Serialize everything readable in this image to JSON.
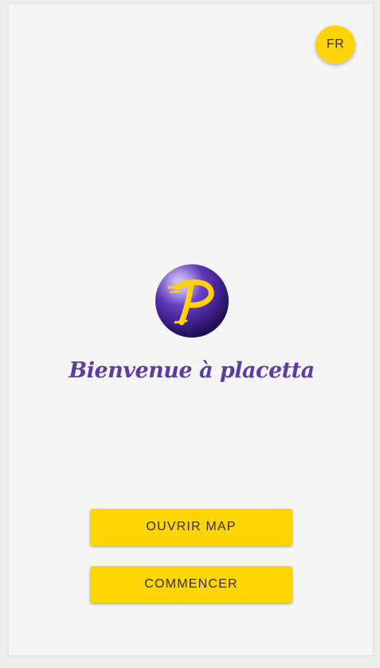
{
  "header": {
    "language_button": "FR"
  },
  "logo": {
    "letter": "P",
    "icon": "placetta-logo-icon"
  },
  "main": {
    "welcome_text": "Bienvenue à placetta"
  },
  "actions": {
    "open_map_label": "OUVRIR MAP",
    "start_label": "COMMENCER"
  },
  "colors": {
    "accent": "#fdd600",
    "brand_purple": "#5e3e9c",
    "background": "#f5f5f5"
  }
}
